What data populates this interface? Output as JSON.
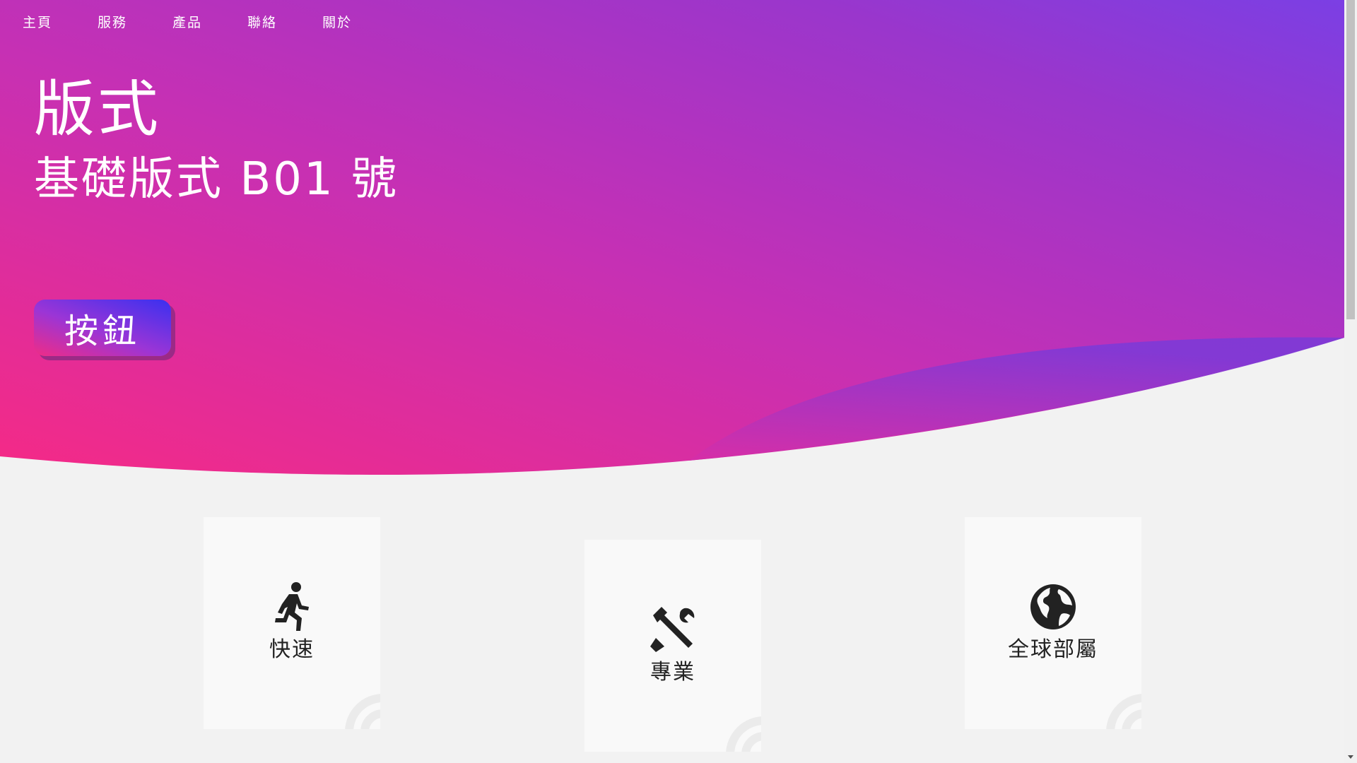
{
  "nav": {
    "items": [
      {
        "label": "主頁"
      },
      {
        "label": "服務"
      },
      {
        "label": "產品"
      },
      {
        "label": "聯絡"
      },
      {
        "label": "關於"
      }
    ]
  },
  "hero": {
    "title": "版式",
    "subtitle": "基礎版式 B01 號",
    "button_label": "按鈕",
    "gradient_colors": {
      "pink": "#f22b86",
      "magenta": "#c231b8",
      "purple": "#7b3fe4",
      "button_blue": "#3a30f0"
    }
  },
  "features": [
    {
      "icon": "running-person-icon",
      "label": "快速"
    },
    {
      "icon": "tools-icon",
      "label": "專業"
    },
    {
      "icon": "globe-icon",
      "label": "全球部屬"
    }
  ]
}
